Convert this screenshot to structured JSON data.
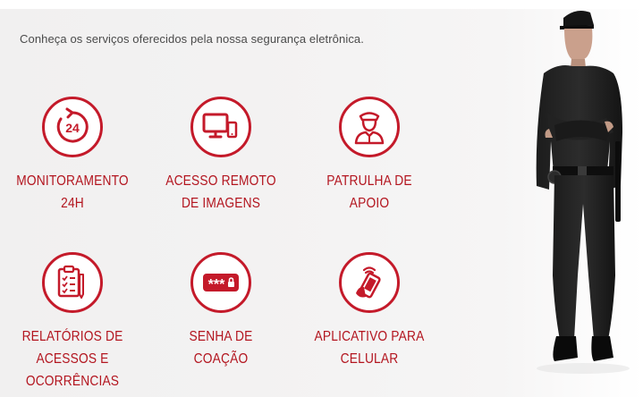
{
  "intro": "Conheça os serviços oferecidos pela nossa segurança eletrônica.",
  "services": [
    {
      "label": "MONITORAMENTO 24H",
      "icon": "clock-24-icon"
    },
    {
      "label": "ACESSO REMOTO DE IMAGENS",
      "icon": "monitor-phone-icon"
    },
    {
      "label": "PATRULHA DE APOIO",
      "icon": "guard-icon"
    },
    {
      "label": "RELATÓRIOS DE ACESSOS E OCORRÊNCIAS",
      "icon": "clipboard-report-icon"
    },
    {
      "label": "SENHA DE COAÇÃO",
      "icon": "password-lock-icon"
    },
    {
      "label": "APLICATIVO PARA CELULAR",
      "icon": "mobile-app-icon"
    }
  ],
  "icon_text": {
    "clock": "24",
    "password": "***"
  },
  "colors": {
    "accent": "#c41a2a",
    "label": "#b3151f",
    "text": "#4a4a4a",
    "background": "#f2f1f1"
  }
}
